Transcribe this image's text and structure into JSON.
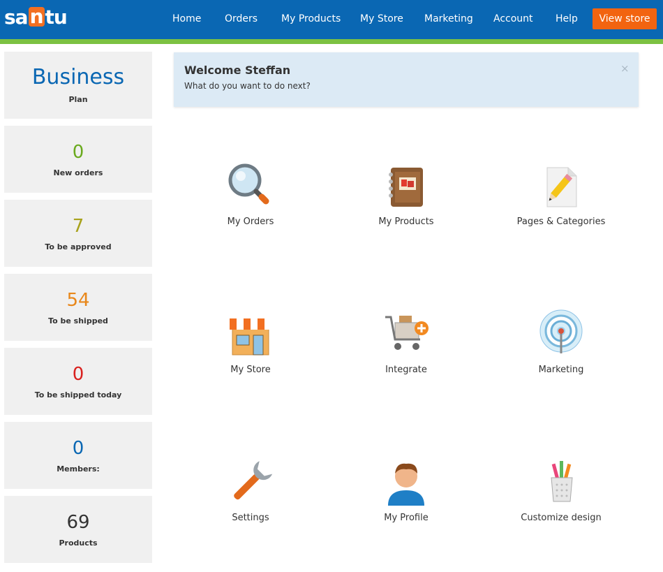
{
  "header": {
    "logo": {
      "pre": "sa",
      "highlight": "n",
      "post": "tu"
    },
    "nav": [
      {
        "label": "Home"
      },
      {
        "label": "Orders"
      },
      {
        "label": "My Products"
      },
      {
        "label": "My Store"
      },
      {
        "label": "Marketing"
      },
      {
        "label": "Account"
      },
      {
        "label": "Help"
      }
    ],
    "view_store": "View store"
  },
  "sidebar": {
    "plan": {
      "value": "Business",
      "label": "Plan"
    },
    "stats": [
      {
        "value": "0",
        "label": "New orders",
        "color": "#6aaa1e"
      },
      {
        "value": "7",
        "label": "To be approved",
        "color": "#a8a21b"
      },
      {
        "value": "54",
        "label": "To be shipped",
        "color": "#e8871a"
      },
      {
        "value": "0",
        "label": "To be shipped today",
        "color": "#d9211f"
      },
      {
        "value": "0",
        "label": "Members:",
        "color": "#0a67b3"
      },
      {
        "value": "69",
        "label": "Products",
        "color": "#333333"
      }
    ]
  },
  "welcome": {
    "title": "Welcome Steffan",
    "subtitle": "What do you want to do next?",
    "close": "×"
  },
  "tiles": [
    {
      "label": "My Orders",
      "icon": "magnifier-icon"
    },
    {
      "label": "My Products",
      "icon": "product-catalog-icon"
    },
    {
      "label": "Pages & Categories",
      "icon": "page-pencil-icon"
    },
    {
      "label": "My Store",
      "icon": "storefront-icon"
    },
    {
      "label": "Integrate",
      "icon": "cart-add-icon"
    },
    {
      "label": "Marketing",
      "icon": "broadcast-icon"
    },
    {
      "label": "Settings",
      "icon": "wrench-icon"
    },
    {
      "label": "My Profile",
      "icon": "user-profile-icon"
    },
    {
      "label": "Customize design",
      "icon": "pencil-cup-icon"
    }
  ],
  "colors": {
    "header_bg": "#0a67b3",
    "accent_green": "#7cc142",
    "view_store_bg": "#f26410",
    "card_bg": "#f0f0f0",
    "welcome_bg": "#dceaf5"
  }
}
